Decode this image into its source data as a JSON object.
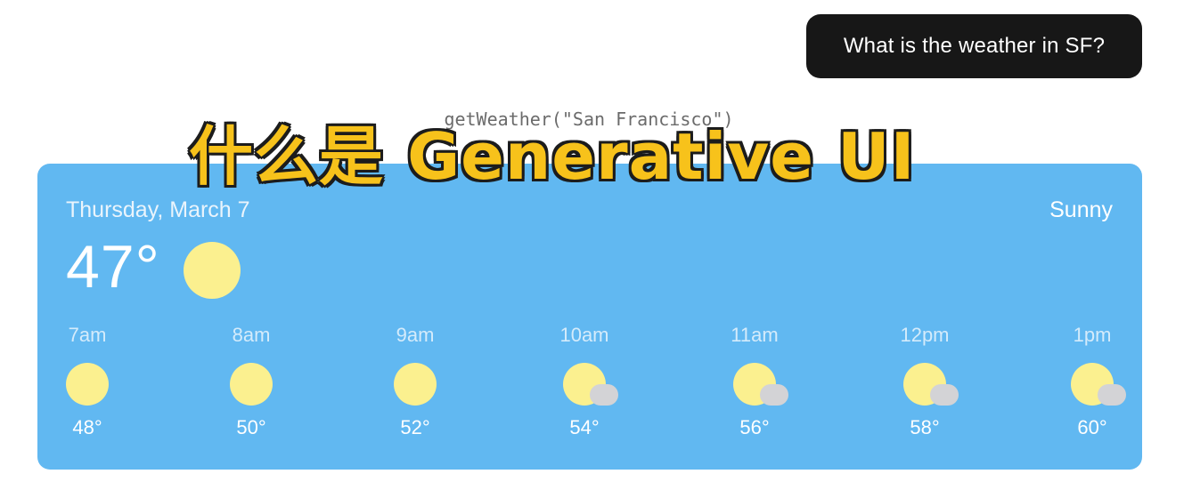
{
  "chat": {
    "user_message": "What is the weather in SF?",
    "tool_call": "getWeather(\"San Francisco\")"
  },
  "overlay_title": "什么是 Generative UI",
  "weather": {
    "date": "Thursday, March 7",
    "condition": "Sunny",
    "current_temp": "47°",
    "current_icon": "sun-icon",
    "hourly": [
      {
        "time": "7am",
        "temp": "48°",
        "icon": "sun-icon"
      },
      {
        "time": "8am",
        "temp": "50°",
        "icon": "sun-icon"
      },
      {
        "time": "9am",
        "temp": "52°",
        "icon": "sun-icon"
      },
      {
        "time": "10am",
        "temp": "54°",
        "icon": "partly-cloudy-icon"
      },
      {
        "time": "11am",
        "temp": "56°",
        "icon": "partly-cloudy-icon"
      },
      {
        "time": "12pm",
        "temp": "58°",
        "icon": "partly-cloudy-icon"
      },
      {
        "time": "1pm",
        "temp": "60°",
        "icon": "partly-cloudy-icon"
      }
    ]
  },
  "colors": {
    "card_background": "#61b8f1",
    "sun": "#fbf08f",
    "cloud": "#d3d3d6",
    "bubble": "#171717",
    "title_fill": "#f7c21b"
  }
}
